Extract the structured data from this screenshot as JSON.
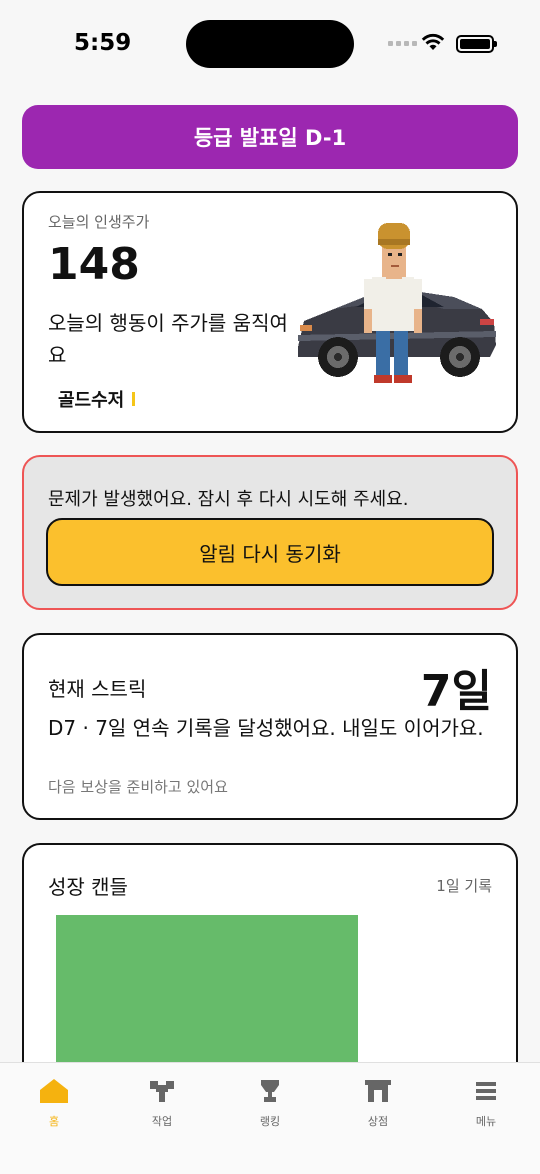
{
  "status_bar": {
    "time": "5:59"
  },
  "banner": {
    "text": "등급 발표일 D-1"
  },
  "stock_card": {
    "label": "오늘의 인생주가",
    "value": "148",
    "description": "오늘의 행동이 주가를 움직여요",
    "tier": "골드수저"
  },
  "error_card": {
    "message": "문제가 발생했어요. 잠시 후 다시 시도해 주세요.",
    "button_label": "알림 다시 동기화"
  },
  "streak_card": {
    "title": "현재 스트릭",
    "value": "7일",
    "description": "D7 · 7일 연속 기록을 달성했어요. 내일도 이어가요.",
    "subtext": "다음 보상을 준비하고 있어요"
  },
  "candle_card": {
    "title": "성장 캔들",
    "record": "1일 기록"
  },
  "tab_bar": {
    "tabs": [
      {
        "label": "홈",
        "icon": "home-icon",
        "active": true
      },
      {
        "label": "작업",
        "icon": "tools-icon",
        "active": false
      },
      {
        "label": "랭킹",
        "icon": "trophy-icon",
        "active": false
      },
      {
        "label": "상점",
        "icon": "store-icon",
        "active": false
      },
      {
        "label": "메뉴",
        "icon": "menu-icon",
        "active": false
      }
    ]
  },
  "colors": {
    "banner": "#9c27b0",
    "retry_button": "#fbc02d",
    "error_border": "#ee5555",
    "candle": "#66bb6a",
    "active_tab": "#f5b20f"
  }
}
